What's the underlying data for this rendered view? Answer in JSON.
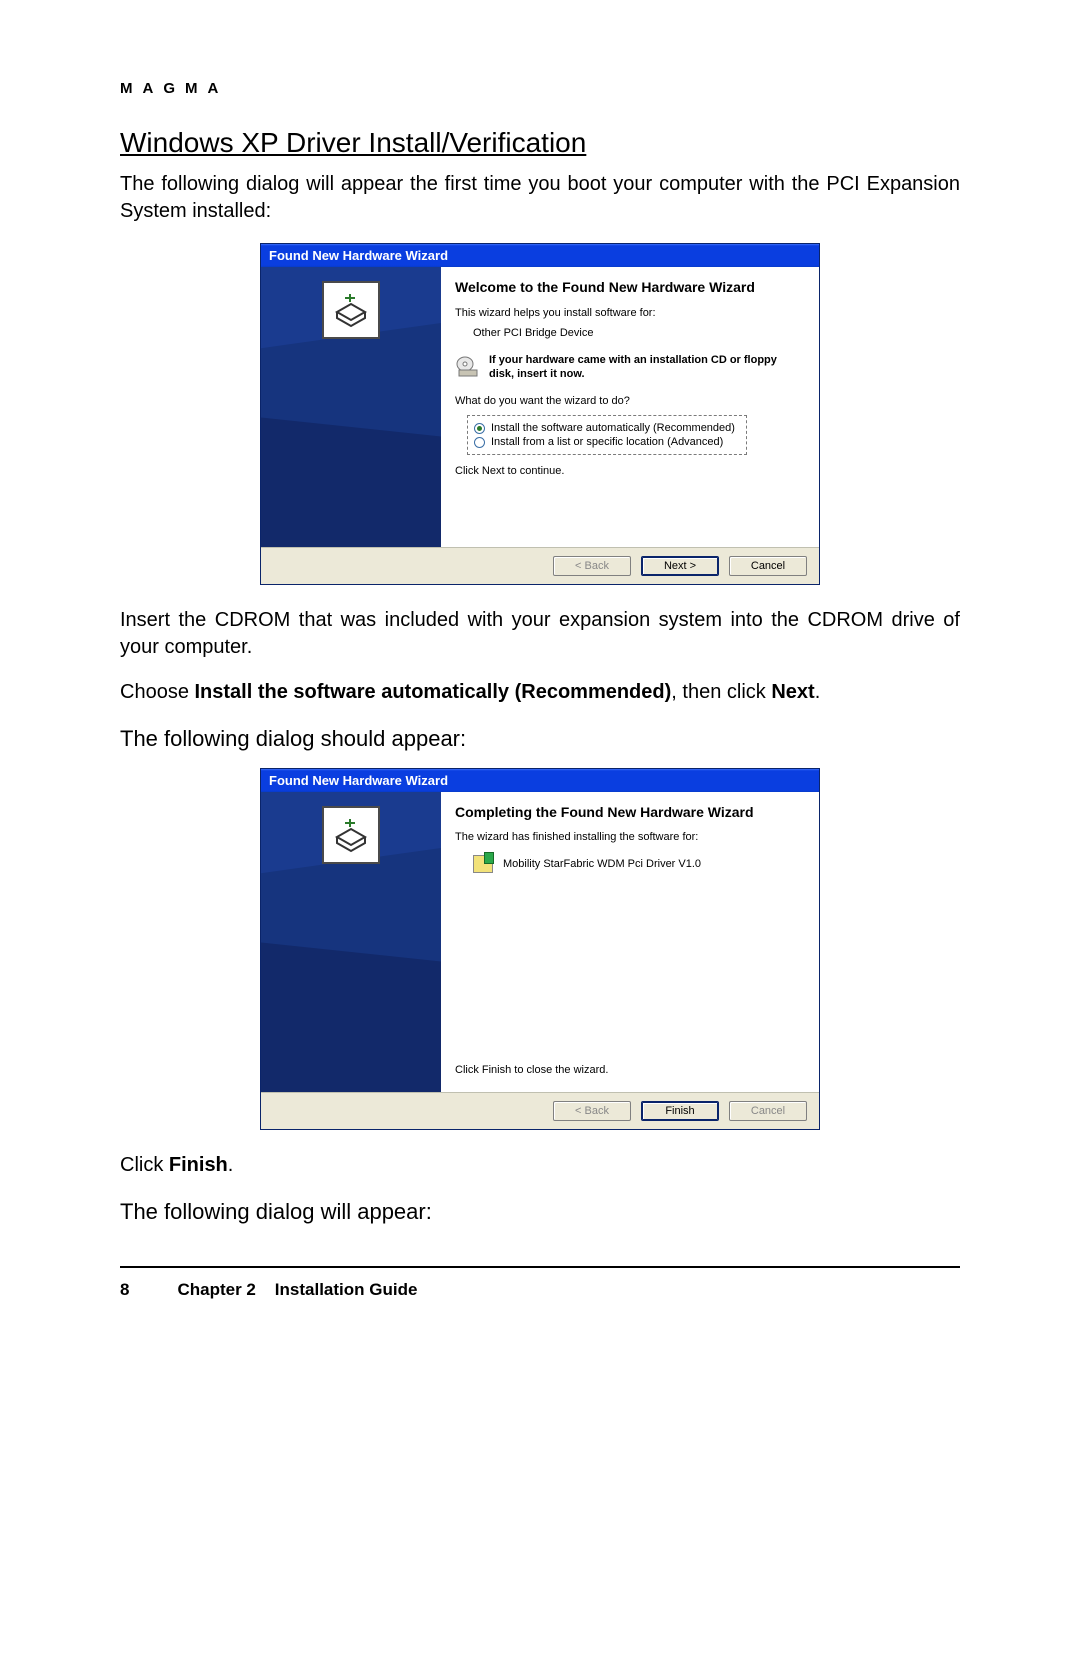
{
  "header": {
    "brand": "MAGMA"
  },
  "section": {
    "title": "Windows XP Driver Install/Verification"
  },
  "para": {
    "intro": "The following dialog will appear the first time you boot your computer with the PCI Expansion System installed:",
    "cdrom": "Insert the CDROM that was included with your expansion system into the CDROM drive of your computer.",
    "choose_pre": "Choose ",
    "choose_bold": "Install the software automatically (Recommended)",
    "choose_mid": ", then click ",
    "choose_bold2": "Next",
    "choose_post": ".",
    "following1": "The following dialog should appear:",
    "click_pre": "Click ",
    "click_bold": "Finish",
    "click_post": ".",
    "following2": "The following dialog will appear:"
  },
  "dialog1": {
    "title": "Found New Hardware Wizard",
    "heading": "Welcome to the Found New Hardware Wizard",
    "helps": "This wizard helps you install software for:",
    "device": "Other PCI Bridge Device",
    "cd_note": "If your hardware came with an installation CD or floppy disk, insert it now.",
    "question": "What do you want the wizard to do?",
    "opt1": "Install the software automatically (Recommended)",
    "opt2": "Install from a list or specific location (Advanced)",
    "continue": "Click Next to continue.",
    "btn_back": "< Back",
    "btn_next": "Next >",
    "btn_cancel": "Cancel"
  },
  "dialog2": {
    "title": "Found New Hardware Wizard",
    "heading": "Completing the Found New Hardware Wizard",
    "finished": "The wizard has finished installing the software for:",
    "driver": "Mobility StarFabric WDM Pci Driver V1.0",
    "close_note": "Click Finish to close the wizard.",
    "btn_back": "< Back",
    "btn_finish": "Finish",
    "btn_cancel": "Cancel"
  },
  "footer": {
    "page": "8",
    "chapter": "Chapter 2",
    "guide": "Installation Guide"
  }
}
